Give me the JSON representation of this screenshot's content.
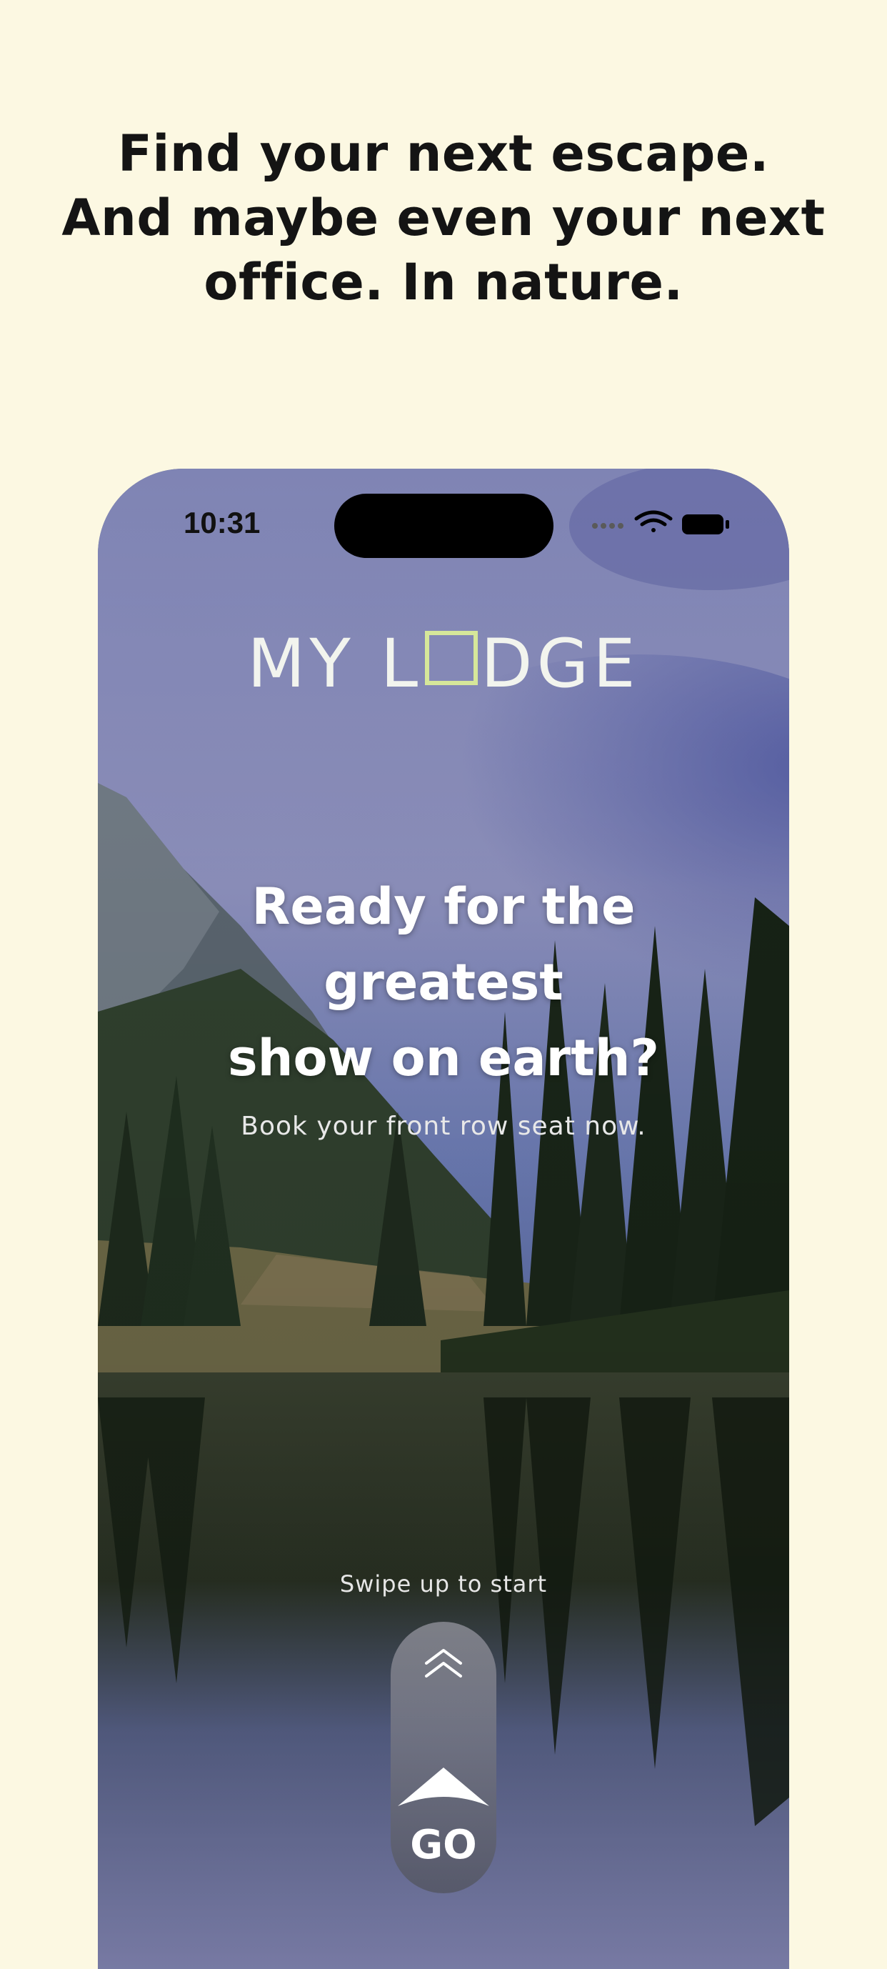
{
  "promo": {
    "headline_lines": [
      "Find your next escape.",
      "And maybe even your next",
      "office. In nature."
    ]
  },
  "status_bar": {
    "time": "10:31"
  },
  "app": {
    "logo": {
      "part1": "MY L",
      "part2": "DGE",
      "box_color": "#d6e79a"
    },
    "hero_lines": [
      "Ready for the",
      "greatest",
      "show on earth?"
    ],
    "subtitle": "Book your front row seat now.",
    "swipe_label": "Swipe up to start",
    "go_label": "GO"
  },
  "icons": [
    "wifi-icon",
    "battery-icon",
    "chevron-up-icon",
    "go-arrow-icon"
  ]
}
